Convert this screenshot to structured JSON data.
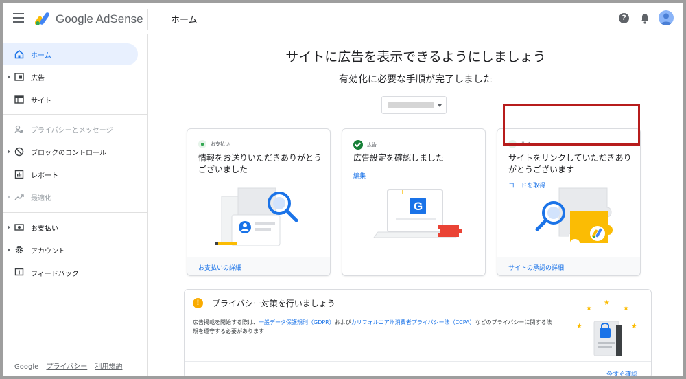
{
  "topbar": {
    "brand": "Google AdSense",
    "page_name": "ホーム",
    "help_glyph": "?"
  },
  "colors": {
    "accent": "#1a73e8",
    "active_nav_bg": "#e8f0fe",
    "success": "#188038",
    "warning": "#f9ab00",
    "highlight_border": "#b71c1c"
  },
  "sidebar": {
    "items": [
      {
        "label": "ホーム",
        "icon": "home-icon",
        "active": true
      },
      {
        "label": "広告",
        "icon": "ad-unit-icon",
        "expandable": true
      },
      {
        "label": "サイト",
        "icon": "site-icon"
      },
      {
        "label": "プライバシーとメッセージ",
        "icon": "people-icon",
        "disabled": true
      },
      {
        "label": "ブロックのコントロール",
        "icon": "block-icon",
        "expandable": true
      },
      {
        "label": "レポート",
        "icon": "report-icon"
      },
      {
        "label": "最適化",
        "icon": "trending-icon",
        "disabled": true,
        "expandable": true
      },
      {
        "label": "お支払い",
        "icon": "payment-icon",
        "expandable": true
      },
      {
        "label": "アカウント",
        "icon": "gear-icon",
        "expandable": true
      },
      {
        "label": "フィードバック",
        "icon": "feedback-icon"
      }
    ],
    "footer": {
      "google": "Google",
      "privacy": "プライバシー",
      "terms": "利用規約"
    }
  },
  "main": {
    "headline": "サイトに広告を表示できるようにしましょう",
    "subhead": "有効化に必要な手順が完了しました",
    "cards": [
      {
        "tag": "お支払い",
        "title": "情報をお送りいただきありがとうございました",
        "link": "",
        "footer": "お支払いの詳細"
      },
      {
        "tag": "広告",
        "title": "広告設定を確認しました",
        "link": "編集",
        "footer": ""
      },
      {
        "tag": "サイト",
        "title": "サイトをリンクしていただきありがとうございます",
        "link": "コードを取得",
        "footer": "サイトの承認の詳細"
      }
    ],
    "privacy": {
      "title": "プライバシー対策を行いましょう",
      "body_pre": "広告掲載を開始する際は、",
      "gdpr_link": "一般データ保護規則（GDPR）",
      "body_mid": "および",
      "ccpa_link": "カリフォルニア州消費者プライバシー法（CCPA）",
      "body_post": "などのプライバシーに関する法規を遵守する必要があります",
      "action": "今すぐ確認"
    }
  }
}
